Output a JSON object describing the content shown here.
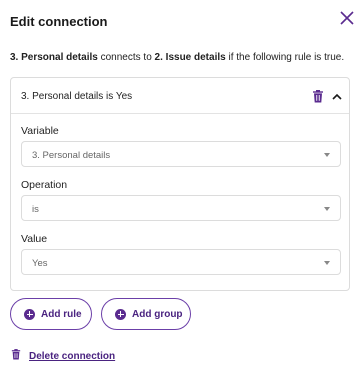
{
  "dialog": {
    "title": "Edit connection",
    "description": {
      "source": "3. Personal details",
      "connects_to": "connects to",
      "target": "2. Issue details",
      "suffix": "if the following rule is true."
    }
  },
  "rule": {
    "header_label": "3. Personal details is Yes",
    "variable_label": "Variable",
    "variable_value": "3. Personal details",
    "operation_label": "Operation",
    "operation_value": "is",
    "value_label": "Value",
    "value_value": "Yes"
  },
  "actions": {
    "add_rule_label": "Add rule",
    "add_group_label": "Add group",
    "delete_connection_label": "Delete connection"
  },
  "colors": {
    "accent": "#5a2b8f",
    "accent_text": "#4a2380",
    "border": "#dcdcdc"
  },
  "icons": {
    "close": "close-icon",
    "trash": "trash-icon",
    "chevron": "chevron-up-icon",
    "caret": "caret-down-icon",
    "plus": "plus-circle-icon"
  }
}
